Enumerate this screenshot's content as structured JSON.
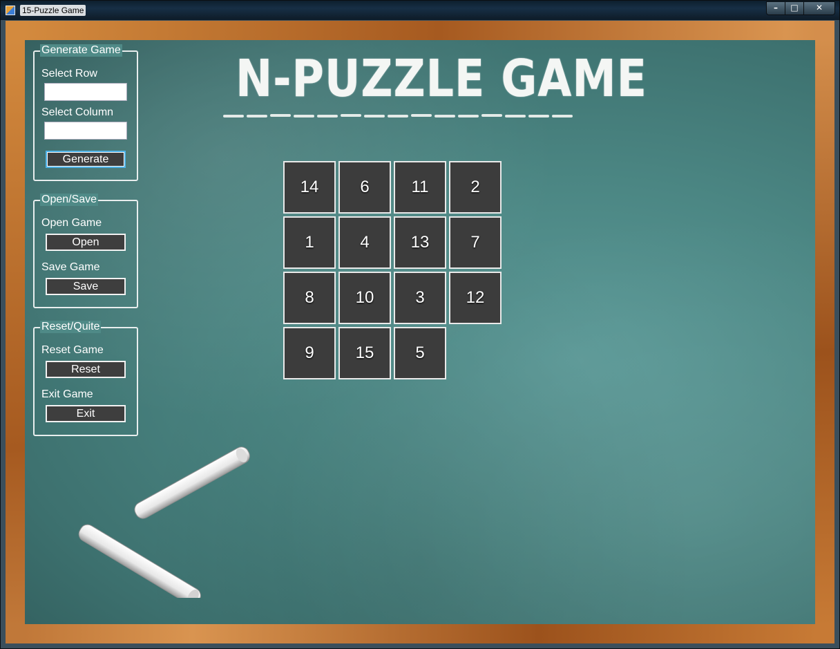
{
  "window": {
    "title": "15-Puzzle Game"
  },
  "controls": {
    "minimize": "–",
    "maximize": "□",
    "close": "✕"
  },
  "generate_group": {
    "title": "Generate Game",
    "row_label": "Select Row",
    "row_value": "",
    "column_label": "Select Column",
    "column_value": "",
    "generate_label": "Generate"
  },
  "open_save_group": {
    "title": "Open/Save",
    "open_label": "Open Game",
    "open_button": "Open",
    "save_label": "Save Game",
    "save_button": "Save"
  },
  "reset_group": {
    "title": "Reset/Quite",
    "reset_label": "Reset Game",
    "reset_button": "Reset",
    "exit_label": "Exit Game",
    "exit_button": "Exit"
  },
  "board": {
    "heading": "N-PUZZLE GAME",
    "rows": 4,
    "columns": 4,
    "tiles": [
      [
        "14",
        "6",
        "11",
        "2"
      ],
      [
        "1",
        "4",
        "13",
        "7"
      ],
      [
        "8",
        "10",
        "3",
        "12"
      ],
      [
        "9",
        "15",
        "5",
        ""
      ]
    ]
  },
  "colors": {
    "chalkboard": "#4b8683",
    "frame_wood": "#b8682a",
    "tile": "#3c3c3c",
    "focus_border": "#4fb3e8"
  },
  "icons": {
    "app": "app-icon",
    "chalk": "chalk-stick-icon"
  }
}
